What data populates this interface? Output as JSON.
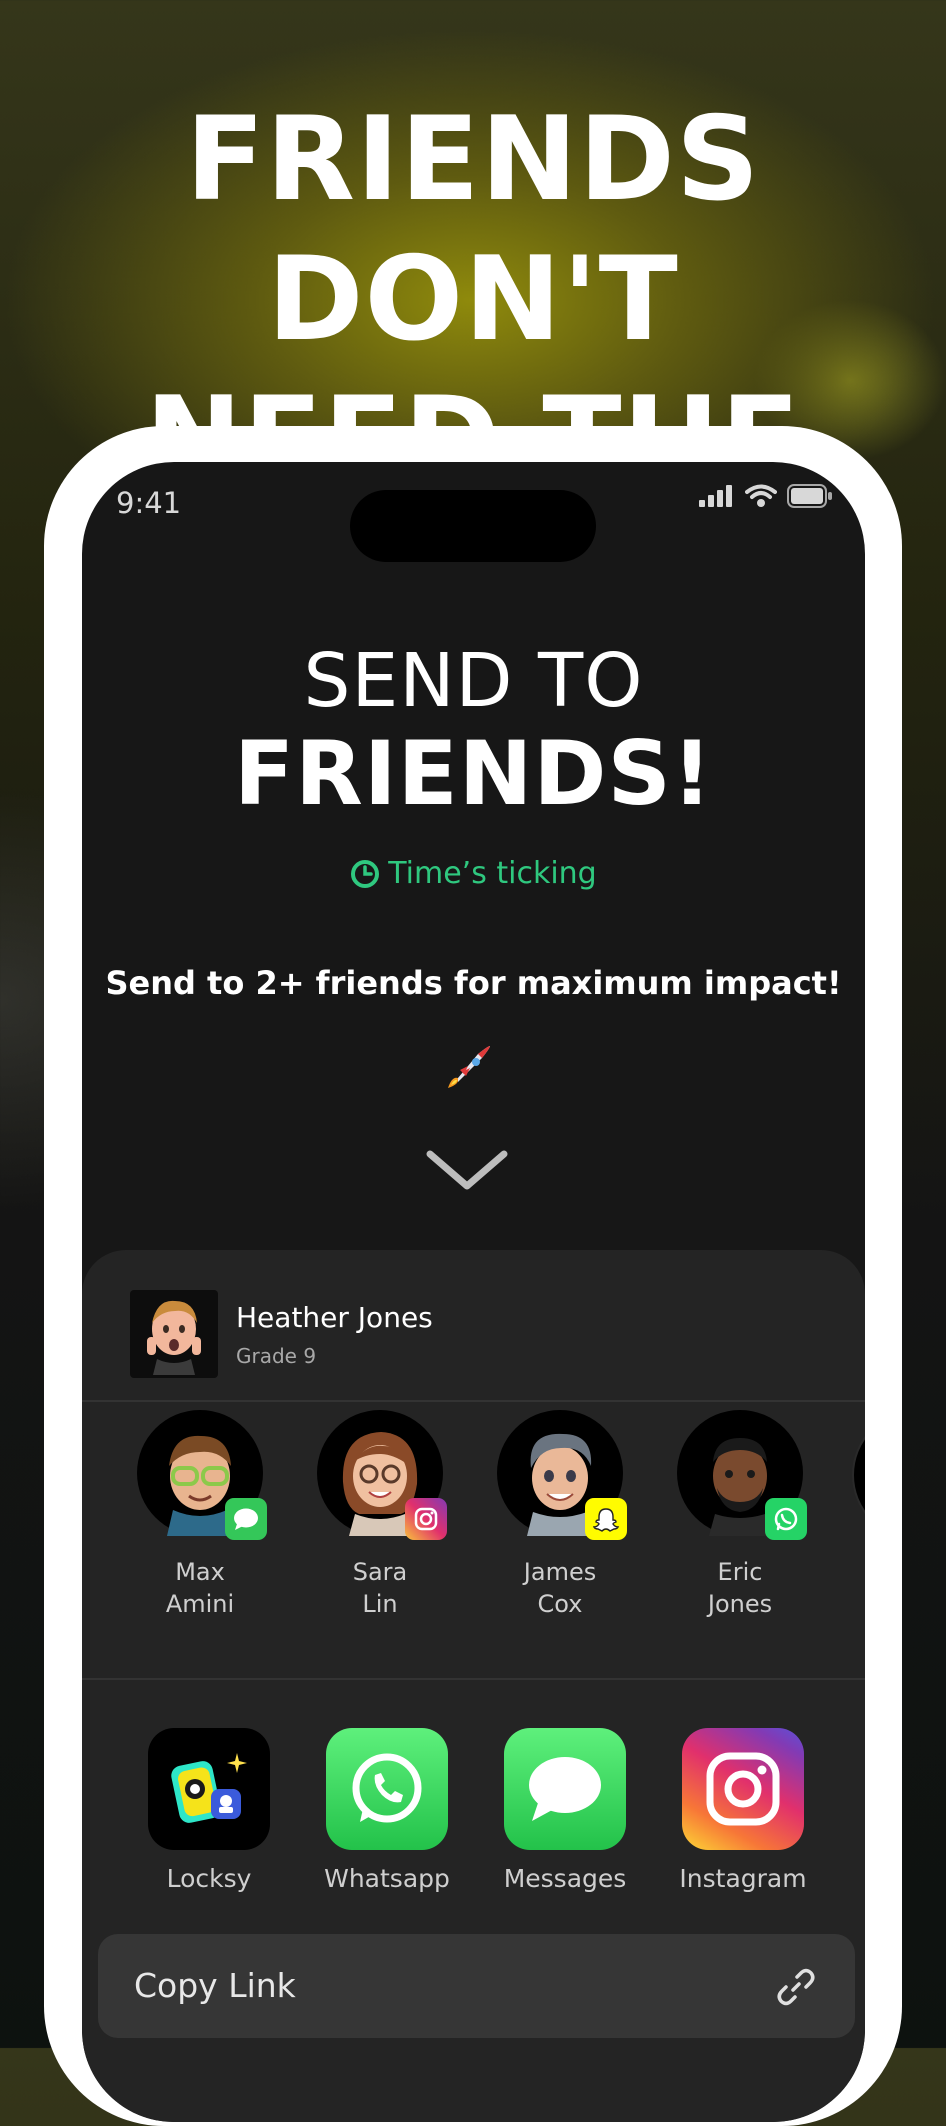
{
  "headline": {
    "line1": "FRIENDS DON'T",
    "line2": "NEED THE APP"
  },
  "status": {
    "time": "9:41"
  },
  "hero": {
    "title_line1": "SEND TO",
    "title_line2": "FRIENDS!",
    "timer_label": "Time’s ticking",
    "subtitle": "Send to 2+ friends for maximum impact!",
    "emoji": "🚀"
  },
  "sheet": {
    "profile": {
      "name": "Heather Jones",
      "grade": "Grade 9"
    },
    "contacts": [
      {
        "first": "Max",
        "last": "Amini",
        "channel": "messages"
      },
      {
        "first": "Sara",
        "last": "Lin",
        "channel": "instagram"
      },
      {
        "first": "James",
        "last": "Cox",
        "channel": "snapchat"
      },
      {
        "first": "Eric",
        "last": "Jones",
        "channel": "whatsapp"
      }
    ],
    "apps": [
      {
        "label": "Locksy"
      },
      {
        "label": "Whatsapp"
      },
      {
        "label": "Messages"
      },
      {
        "label": "Instagram"
      }
    ],
    "copy_link_label": "Copy Link"
  },
  "colors": {
    "accent_green": "#2fc87f",
    "whatsapp": "#25d366",
    "messages": "#34c759",
    "snapchat": "#fffc00"
  }
}
